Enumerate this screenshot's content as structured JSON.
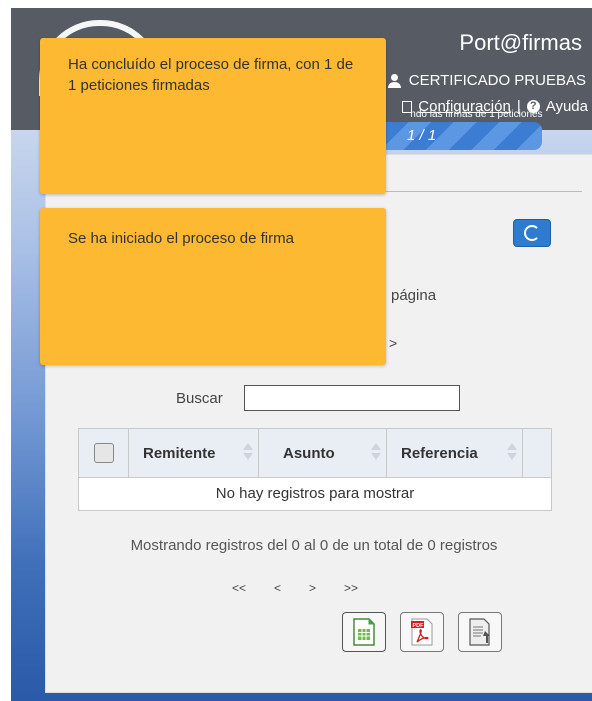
{
  "header": {
    "app_title": "Port@firmas",
    "user_name": "CERTIFICADO PRUEBAS",
    "config_label": "Configuración",
    "separator": "|",
    "help_label": "Ayuda",
    "overlay_text": "ndo las firmas de 1 peticiones"
  },
  "progress": {
    "label": "1 / 1",
    "fraction": 1.0
  },
  "toasts": [
    {
      "text": "Ha concluído el proceso de firma, con 1 de 1 peticiones firmadas"
    },
    {
      "text": "Se ha iniciado el proceso de firma"
    }
  ],
  "panel": {
    "partial_pagina": "página",
    "partial_arrow": ">"
  },
  "search": {
    "label": "Buscar",
    "value": ""
  },
  "table": {
    "headers": [
      "Remitente",
      "Asunto",
      "Referencia"
    ],
    "empty_message": "No hay registros para mostrar"
  },
  "footer": {
    "info": "Mostrando registros del 0 al 0 de un total de 0 registros",
    "pager": [
      "<<",
      "<",
      ">",
      ">>"
    ]
  },
  "exports": [
    {
      "name": "calc",
      "icon": "spreadsheet-icon"
    },
    {
      "name": "pdf",
      "icon": "pdf-icon"
    },
    {
      "name": "doc",
      "icon": "document-icon"
    }
  ],
  "colors": {
    "toast": "#fdb931",
    "header": "#575c64",
    "accent": "#2f7bd0"
  }
}
